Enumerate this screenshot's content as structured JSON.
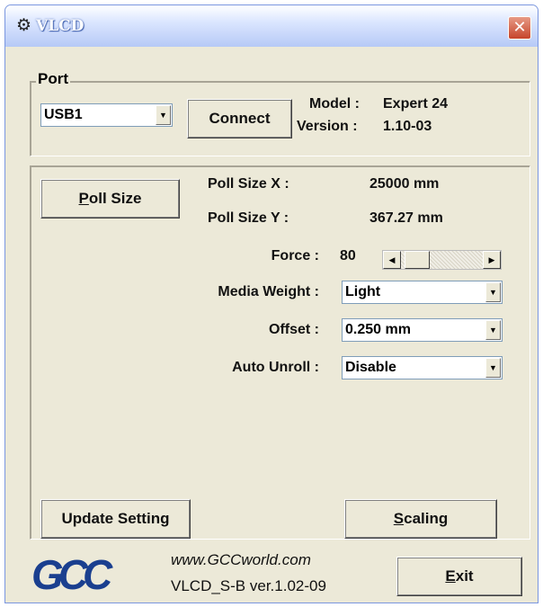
{
  "window": {
    "title": "VLCD",
    "close_glyph": "✕"
  },
  "port": {
    "group_label": "Port",
    "selected": "USB1",
    "connect_label": "Connect",
    "model_label": "Model :",
    "model_value": "Expert 24",
    "version_label": "Version :",
    "version_value": "1.10-03"
  },
  "settings": {
    "poll_size_button": {
      "prefix": "",
      "mnemonic": "P",
      "rest": "oll Size"
    },
    "poll_size_x_label": "Poll Size X :",
    "poll_size_x_value": "25000 mm",
    "poll_size_y_label": "Poll Size Y :",
    "poll_size_y_value": "367.27 mm",
    "force_label": "Force :",
    "force_value": "80",
    "media_weight_label": "Media Weight :",
    "media_weight_value": "Light",
    "offset_label": "Offset :",
    "offset_value": "0.250 mm",
    "auto_unroll_label": "Auto Unroll :",
    "auto_unroll_value": "Disable",
    "update_setting_label": "Update Setting",
    "scaling_button": {
      "mnemonic": "S",
      "rest": "caling"
    }
  },
  "footer": {
    "logo_text": "GCC",
    "website": "www.GCCworld.com",
    "version_line": "VLCD_S-B ver.1.02-09",
    "exit_button": {
      "mnemonic": "E",
      "rest": "xit"
    }
  },
  "colors": {
    "dialog_bg": "#ece9d8",
    "logo_blue": "#1a3f8f",
    "close_red": "#c6452a"
  }
}
